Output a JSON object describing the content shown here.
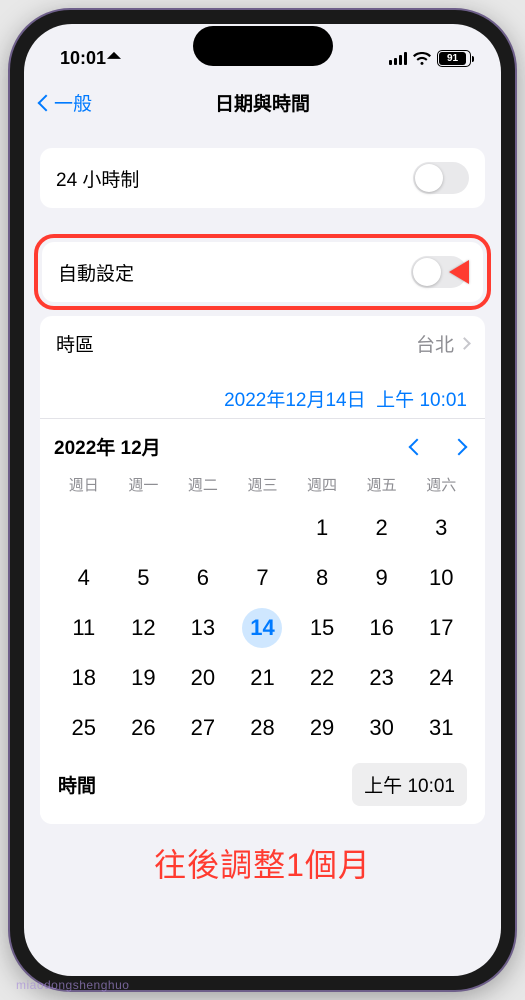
{
  "status": {
    "time": "10:01",
    "battery": "91"
  },
  "nav": {
    "back_label": "一般",
    "title": "日期與時間"
  },
  "rows": {
    "h24_label": "24 小時制",
    "auto_label": "自動設定",
    "tz_label": "時區",
    "tz_value": "台北"
  },
  "datetime": {
    "date_text": "2022年12月14日",
    "time_text": "上午 10:01"
  },
  "calendar": {
    "month_title": "2022年 12月",
    "weekdays": [
      "週日",
      "週一",
      "週二",
      "週三",
      "週四",
      "週五",
      "週六"
    ],
    "weeks": [
      [
        "",
        "",
        "",
        "",
        "1",
        "2",
        "3"
      ],
      [
        "4",
        "5",
        "6",
        "7",
        "8",
        "9",
        "10"
      ],
      [
        "11",
        "12",
        "13",
        "14",
        "15",
        "16",
        "17"
      ],
      [
        "18",
        "19",
        "20",
        "21",
        "22",
        "23",
        "24"
      ],
      [
        "25",
        "26",
        "27",
        "28",
        "29",
        "30",
        "31"
      ]
    ],
    "selected_day": "14"
  },
  "time_row": {
    "label": "時間",
    "value": "上午 10:01"
  },
  "annotation": "往後調整1個月",
  "watermark": "miaodongshenghuo"
}
